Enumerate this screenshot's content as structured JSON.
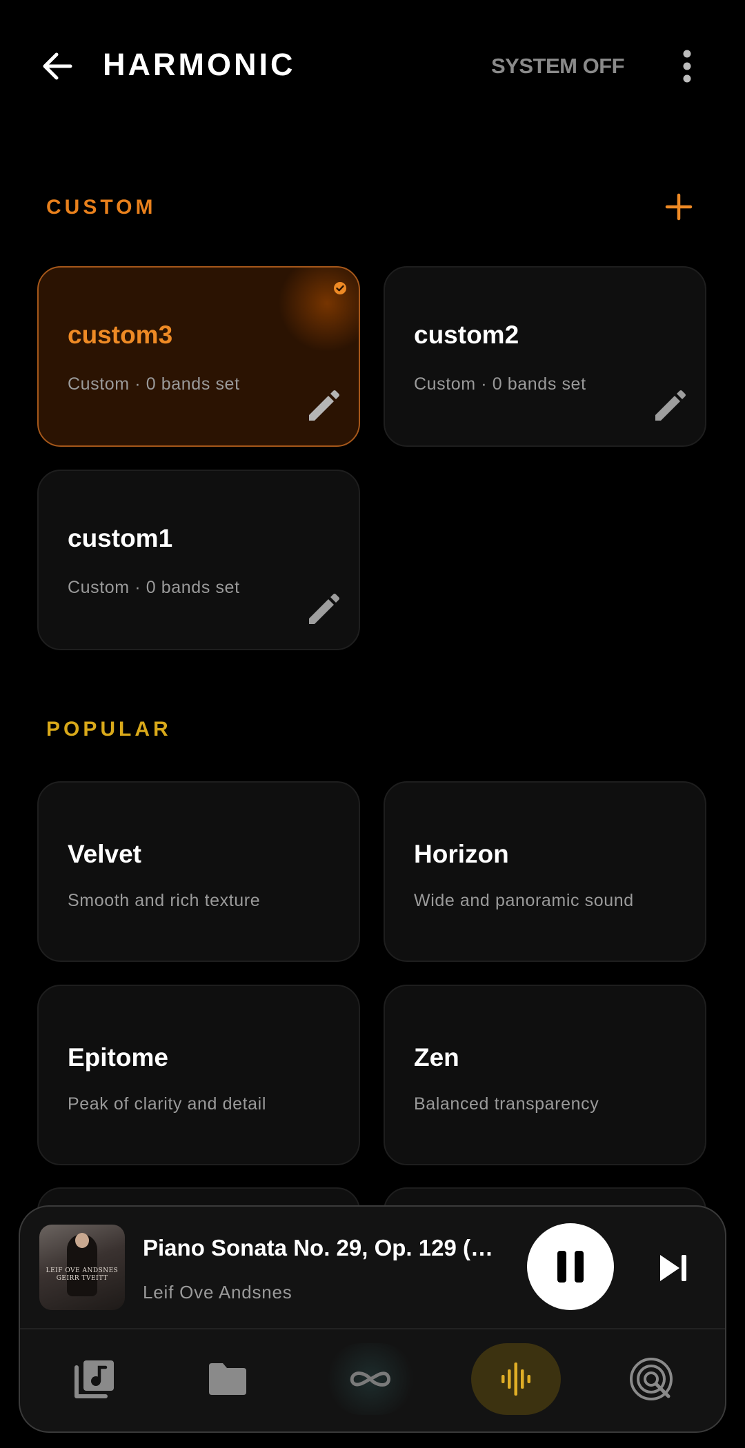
{
  "header": {
    "title": "HARMONIC",
    "system_status": "SYSTEM OFF"
  },
  "sections": {
    "custom_title": "CUSTOM",
    "popular_title": "POPULAR"
  },
  "custom_presets": [
    {
      "name": "custom3",
      "subtitle": "Custom · 0 bands set",
      "selected": true
    },
    {
      "name": "custom2",
      "subtitle": "Custom · 0 bands set",
      "selected": false
    },
    {
      "name": "custom1",
      "subtitle": "Custom · 0 bands set",
      "selected": false
    }
  ],
  "popular_presets": [
    {
      "name": "Velvet",
      "subtitle": "Smooth and rich texture"
    },
    {
      "name": "Horizon",
      "subtitle": "Wide and panoramic sound"
    },
    {
      "name": "Epitome",
      "subtitle": "Peak of clarity and detail"
    },
    {
      "name": "Zen",
      "subtitle": "Balanced transparency"
    }
  ],
  "player": {
    "track_title": "Piano Sonata No. 29, Op. 129 (…",
    "artist": "Leif Ove Andsnes",
    "album_art_text": "LEIF OVE ANDSNES GEIRR TVEITT",
    "state": "playing"
  },
  "bottom_nav": {
    "items": [
      "library-icon",
      "folder-icon",
      "infinity-icon",
      "equalizer-icon",
      "radar-icon"
    ],
    "active": "equalizer-icon"
  },
  "colors": {
    "accent_orange": "#ee8a25",
    "accent_yellow": "#d9a91a",
    "background": "#000000",
    "card": "#0f0f0f"
  }
}
